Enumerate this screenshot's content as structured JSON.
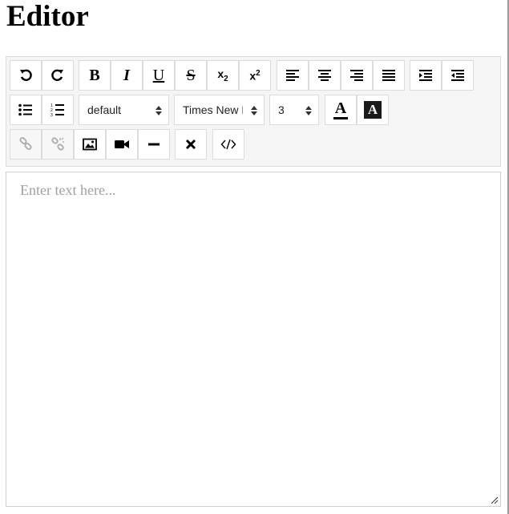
{
  "page": {
    "title": "Editor"
  },
  "toolbar": {
    "undo": {
      "icon": "undo-icon"
    },
    "redo": {
      "icon": "redo-icon"
    },
    "bold": {
      "label": "B"
    },
    "italic": {
      "label": "I"
    },
    "underline": {
      "label": "U"
    },
    "strikethrough": {
      "label": "S"
    },
    "subscript": {
      "base": "x",
      "script": "2"
    },
    "superscript": {
      "base": "x",
      "script": "2"
    },
    "align_left": {
      "icon": "align-left-icon"
    },
    "align_center": {
      "icon": "align-center-icon"
    },
    "align_right": {
      "icon": "align-right-icon"
    },
    "justify": {
      "icon": "justify-icon"
    },
    "indent": {
      "icon": "indent-icon"
    },
    "outdent": {
      "icon": "outdent-icon"
    },
    "bullet_list": {
      "icon": "bullet-list-icon"
    },
    "numbered_list": {
      "icon": "numbered-list-icon"
    },
    "format_select": {
      "value": "default"
    },
    "font_select": {
      "value": "Times New Roman"
    },
    "size_select": {
      "value": "3"
    },
    "font_color": {
      "label": "A"
    },
    "background_color": {
      "label": "A"
    },
    "link": {
      "icon": "link-icon",
      "disabled": true
    },
    "unlink": {
      "icon": "unlink-icon",
      "disabled": true
    },
    "image": {
      "icon": "image-icon"
    },
    "video": {
      "icon": "video-icon"
    },
    "horizontal_rule": {
      "icon": "horizontal-rule-icon"
    },
    "remove_format": {
      "icon": "close-icon"
    },
    "source": {
      "icon": "code-icon"
    }
  },
  "editor": {
    "placeholder": "Enter text here..."
  }
}
